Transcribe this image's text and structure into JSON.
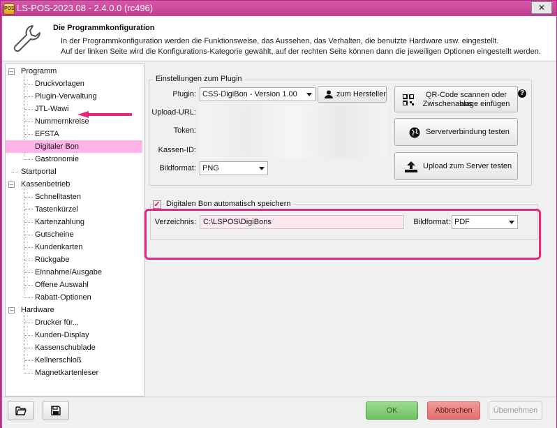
{
  "window": {
    "title": "LS-POS-2023.08 - 2.4.0.0 (rc496)",
    "close_label": "✕"
  },
  "header": {
    "title": "Die Programmkonfiguration",
    "line1": "In der Programmkonfiguration werden die Funktionsweise, das Aussehen, das Verhalten, die benutzte Hardware usw. eingestellt.",
    "line2": "Auf der linken Seite wird die Konfigurations-Kategorie gewählt, auf der rechten Seite können dann die jeweiligen Optionen eingestellt werden."
  },
  "tree": {
    "groups": [
      {
        "label": "Programm",
        "children": [
          "Druckvorlagen",
          "Plugin-Verwaltung",
          "JTL-Wawi",
          "Nummernkreise",
          "EFSTA",
          "Digitaler Bon",
          "Gastronomie"
        ]
      },
      {
        "label": "Startportal",
        "children": []
      },
      {
        "label": "Kassenbetrieb",
        "children": [
          "Schnelltasten",
          "Tastenkürzel",
          "Kartenzahlung",
          "Gutscheine",
          "Kundenkarten",
          "Rückgabe",
          "Einnahme/Ausgabe",
          "Offene Auswahl",
          "Rabatt-Optionen"
        ]
      },
      {
        "label": "Hardware",
        "children": [
          "Drucker für...",
          "Kunden-Display",
          "Kassenschublade",
          "Kellnerschloß",
          "Magnetkartenleser"
        ]
      }
    ],
    "selected": "Digitaler Bon"
  },
  "plugin_settings": {
    "legend": "Einstellungen zum Plugin",
    "plugin_label": "Plugin:",
    "plugin_value": "CSS-DigiBon - Version 1.00",
    "manufacturer_button": "zum Hersteller",
    "upload_url_label": "Upload-URL:",
    "token_label": "Token:",
    "kassen_id_label": "Kassen-ID:",
    "bildformat_label": "Bildformat:",
    "bildformat_value": "PNG",
    "qr_button_line1": "QR-Code scannen oder aus",
    "qr_button_line2": "Zwischenablage einfügen",
    "server_test_button": "Serververbindung testen",
    "upload_test_button": "Upload zum Server testen"
  },
  "autosave": {
    "checkbox_label": "Digitalen Bon automatisch speichern",
    "checked": true,
    "directory_label": "Verzeichnis:",
    "directory_value": "C:\\LSPOS\\DigiBons",
    "bildformat_label": "Bildformat:",
    "bildformat_value": "PDF"
  },
  "footer": {
    "ok": "OK",
    "cancel": "Abbrechen",
    "apply": "Übernehmen"
  },
  "colors": {
    "titlebar": "#c8419a",
    "selection": "#ffb3e6",
    "highlight": "#e8267f",
    "ok_button": "#7dcb6f",
    "cancel_button": "#ec7a7a"
  }
}
